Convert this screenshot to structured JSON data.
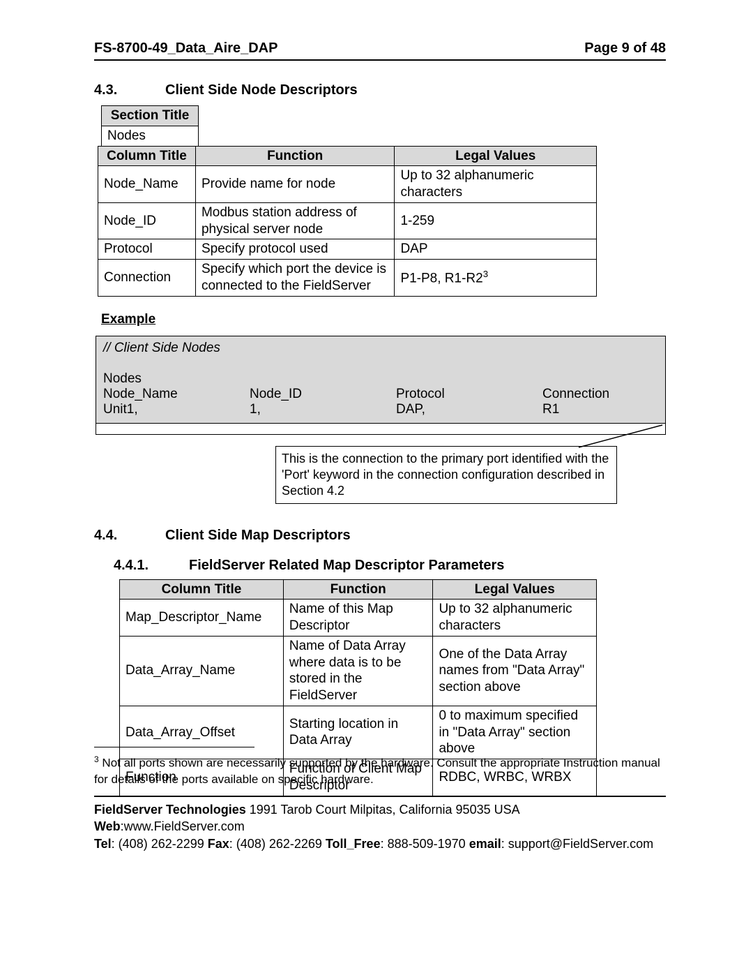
{
  "header": {
    "doc": "FS-8700-49_Data_Aire_DAP",
    "page": "Page 9 of 48"
  },
  "s43": {
    "num": "4.3.",
    "title": "Client Side Node Descriptors",
    "section_title_h": "Section Title",
    "section_title_v": "Nodes",
    "col_h1": "Column Title",
    "col_h2": "Function",
    "col_h3": "Legal Values",
    "rows": [
      {
        "c1": "Node_Name",
        "c2": "Provide name for node",
        "c3": "Up to 32 alphanumeric characters"
      },
      {
        "c1": "Node_ID",
        "c2": "Modbus station address of physical server node",
        "c3": "1-259"
      },
      {
        "c1": "Protocol",
        "c2": "Specify protocol used",
        "c3": "DAP"
      },
      {
        "c1": "Connection",
        "c2": "Specify which port the device is connected to the FieldServer",
        "c3": "P1-P8, R1-R2",
        "sup": "3"
      }
    ]
  },
  "example": {
    "label": "Example",
    "comment": "//    Client Side Nodes",
    "l1": "Nodes",
    "h": {
      "a": "Node_Name",
      "b": "Node_ID",
      "c": "Protocol",
      "d": "Connection"
    },
    "v": {
      "a": "Unit1,",
      "b": "1,",
      "c": "DAP,",
      "d": "R1"
    },
    "callout": "This is the connection to the primary port identified with the 'Port' keyword in the connection configuration described in Section 4.2"
  },
  "s44": {
    "num": "4.4.",
    "title": "Client Side Map Descriptors",
    "s441": {
      "num": "4.4.1.",
      "title": "FieldServer Related Map Descriptor Parameters",
      "col_h1": "Column Title",
      "col_h2": "Function",
      "col_h3": "Legal Values",
      "rows": [
        {
          "c1": "Map_Descriptor_Name",
          "c2": "Name of this Map Descriptor",
          "c3": "Up to 32 alphanumeric characters"
        },
        {
          "c1": "Data_Array_Name",
          "c2": "Name of Data Array where data is to be stored in the FieldServer",
          "c3": "One of the Data Array names from \"Data Array\" section above"
        },
        {
          "c1": "Data_Array_Offset",
          "c2": "Starting location in Data Array",
          "c3": "0 to maximum specified in \"Data Array\" section above"
        },
        {
          "c1": "Function",
          "c2": "Function of Client Map Descriptor",
          "c3": "RDBC, WRBC, WRBX"
        }
      ]
    }
  },
  "footnote": {
    "sup": "3",
    "text": " Not all ports shown are necessarily supported by the hardware. Consult the appropriate Instruction manual for details of the ports available on specific hardware."
  },
  "footer": {
    "l1a": "FieldServer Technologies",
    "l1b": " 1991 Tarob Court Milpitas, California 95035 USA  ",
    "l1c": "Web",
    "l1d": ":www.FieldServer.com",
    "l2a": "Tel",
    "l2b": ": (408) 262-2299  ",
    "l2c": "Fax",
    "l2d": ": (408) 262-2269   ",
    "l2e": "Toll_Free",
    "l2f": ": 888-509-1970   ",
    "l2g": "email",
    "l2h": ": support@FieldServer.com"
  }
}
